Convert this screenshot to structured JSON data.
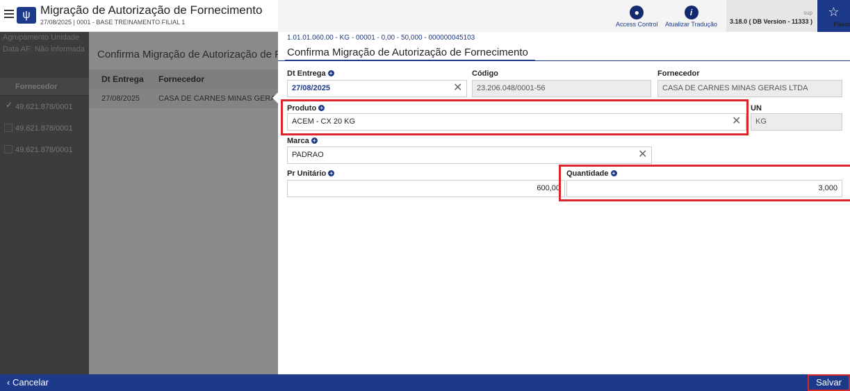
{
  "header": {
    "title": "Migração de Autorização de Fornecimento",
    "subtitle": "27/08/2025 | 0001 - BASE TREINAMENTO FILIAL 1",
    "tools": [
      {
        "label": "Access Control",
        "icon": "lock-icon"
      },
      {
        "label": "Atualizar Tradução",
        "icon": "info-icon"
      }
    ],
    "user": "sup",
    "version": "3.18.0 ( DB Version - 11333 )",
    "favorites_label": "Favoritos"
  },
  "left_panel": {
    "info_line1": "Agrupamento Unidade",
    "info_line2": "Data AF: Não informada",
    "column_header": "Fornecedor",
    "rows": [
      "49.621.878/0001",
      "49.621.878/0001",
      "49.621.878/0001"
    ]
  },
  "middle_panel": {
    "title": "Confirma Migração de Autorização de Fornecimento",
    "columns": [
      "Dt Entrega",
      "Fornecedor"
    ],
    "row": {
      "dt_entrega": "27/08/2025",
      "fornecedor": "CASA DE CARNES MINAS GERAIS LTDA"
    }
  },
  "form": {
    "breadcrumb": "1.01.01.060.00 - KG - 00001 - 0,00 - 50,000 - 000000045103",
    "title": "Confirma Migração de Autorização de Fornecimento",
    "dt_entrega": {
      "label": "Dt Entrega",
      "value": "27/08/2025"
    },
    "codigo": {
      "label": "Código",
      "value": "23.206.048/0001-56"
    },
    "fornecedor": {
      "label": "Fornecedor",
      "value": "CASA DE CARNES MINAS GERAIS LTDA"
    },
    "produto": {
      "label": "Produto",
      "value": "ACEM - CX 20 KG"
    },
    "un": {
      "label": "UN",
      "value": "KG"
    },
    "marca": {
      "label": "Marca",
      "value": "PADRAO"
    },
    "pr_unitario": {
      "label": "Pr Unitário",
      "value": "600,00"
    },
    "quantidade": {
      "label": "Quantidade",
      "value": "3,000"
    }
  },
  "footer": {
    "cancel_label": "Cancelar",
    "save_label": "Salvar"
  },
  "colors": {
    "primary": "#1d3a8a",
    "highlight": "#d9252b"
  }
}
